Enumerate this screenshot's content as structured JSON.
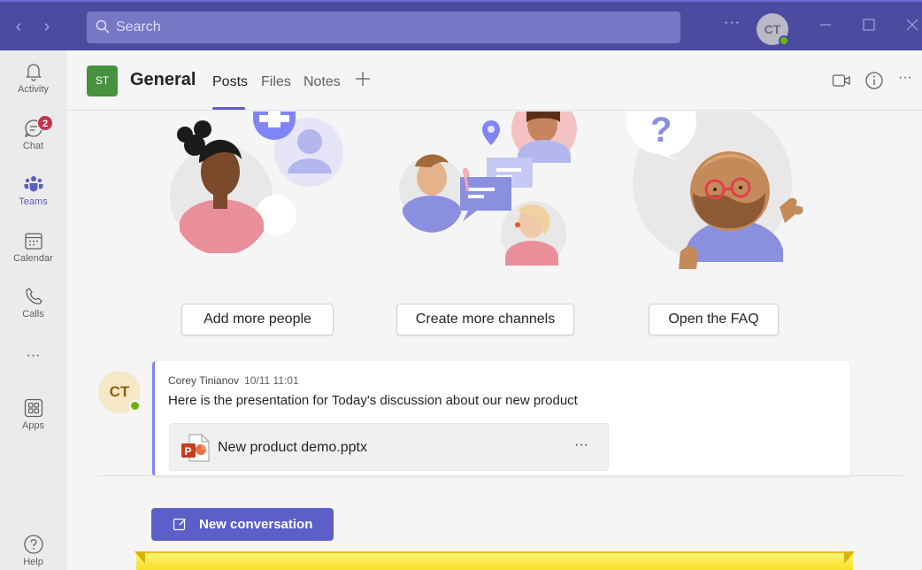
{
  "titlebar": {
    "search_placeholder": "Search",
    "more_label": "···",
    "user_initials": "CT"
  },
  "rail": {
    "items": [
      {
        "label": "Activity",
        "icon": "bell-icon"
      },
      {
        "label": "Chat",
        "icon": "chat-icon",
        "badge": "2"
      },
      {
        "label": "Teams",
        "icon": "teams-icon",
        "active": true
      },
      {
        "label": "Calendar",
        "icon": "calendar-icon"
      },
      {
        "label": "Calls",
        "icon": "phone-icon"
      },
      {
        "label": "···",
        "icon": "more-apps-icon"
      },
      {
        "label": "Apps",
        "icon": "apps-icon"
      },
      {
        "label": "Help",
        "icon": "help-icon"
      }
    ]
  },
  "channel": {
    "team_initials": "ST",
    "title": "General",
    "tabs": [
      {
        "label": "Posts",
        "active": true
      },
      {
        "label": "Files"
      },
      {
        "label": "Notes"
      }
    ],
    "header_more": "···"
  },
  "actions": {
    "add_people": "Add more people",
    "create_channels": "Create more channels",
    "open_faq": "Open the FAQ"
  },
  "post": {
    "author_initials": "CT",
    "author": "Corey Tinianov",
    "timestamp": "10/11 11:01",
    "text": "Here is the presentation for Today's discussion about our new product",
    "attachment": {
      "name": "New product demo.pptx",
      "icon": "powerpoint-file-icon",
      "more": "···"
    }
  },
  "compose": {
    "new_conversation": "New conversation"
  },
  "colors": {
    "titlebar": "#4b4ca0",
    "accent": "#5b5fc7",
    "team_tile": "#47913f",
    "badge": "#c4314b",
    "presence": "#6bb700"
  }
}
